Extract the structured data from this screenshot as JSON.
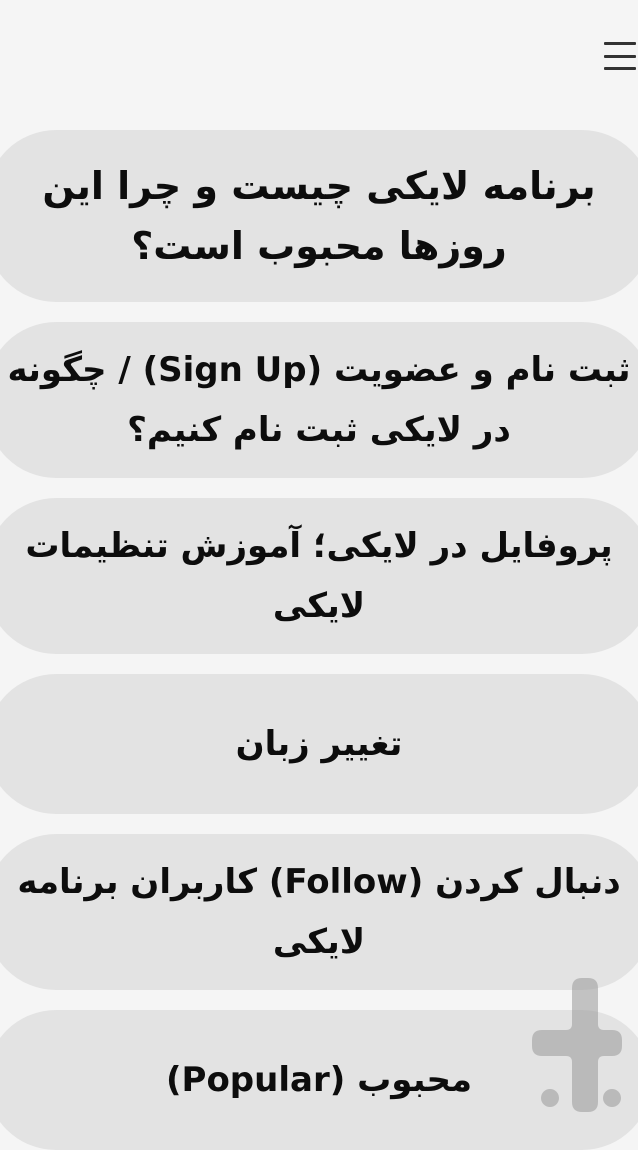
{
  "header": {
    "menu_icon": "hamburger-menu-icon"
  },
  "items": [
    {
      "label": "برنامه لایکی چیست و چرا این روزها محبوب است؟"
    },
    {
      "label": "ثبت نام و عضویت (Sign Up) / چگونه در لایکی ثبت نام کنیم؟"
    },
    {
      "label": "پروفایل در لایکی؛ آموزش تنظیمات لایکی"
    },
    {
      "label": "تغییر زبان"
    },
    {
      "label": "دنبال کردن (Follow) کاربران برنامه لایکی"
    },
    {
      "label": "محبوب (Popular)"
    }
  ],
  "watermark": {
    "icon": "cafebazaar-logo-icon"
  },
  "colors": {
    "background": "#f5f5f5",
    "card": "#e3e3e3",
    "text": "#0d0d0d",
    "icon": "#333333",
    "watermark": "#9a9a9a"
  }
}
